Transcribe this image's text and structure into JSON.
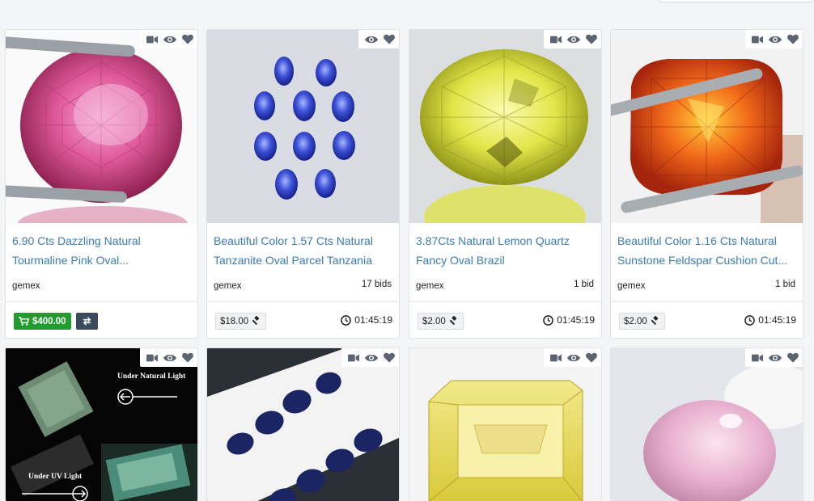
{
  "cards": [
    {
      "title": "6.90 Cts Dazzling Natural Tourmaline Pink Oval...",
      "seller": "gemex",
      "bids": "",
      "buy_now": "$400.00",
      "price": "",
      "timer": "",
      "icons": [
        "video-icon",
        "eye-icon",
        "heart-icon"
      ]
    },
    {
      "title": "Beautiful Color 1.57 Cts Natural Tanzanite Oval Parcel Tanzania",
      "seller": "gemex",
      "bids": "17 bids",
      "price": "$18.00",
      "timer": "01:45:19",
      "icons": [
        "eye-icon",
        "heart-icon"
      ]
    },
    {
      "title": "3.87Cts Natural Lemon Quartz Fancy Oval Brazil",
      "seller": "gemex",
      "bids": "1 bid",
      "price": "$2.00",
      "timer": "01:45:19",
      "icons": [
        "video-icon",
        "eye-icon",
        "heart-icon"
      ]
    },
    {
      "title": "Beautiful Color 1.16 Cts Natural Sunstone Feldspar Cushion Cut...",
      "seller": "gemex",
      "bids": "1 bid",
      "price": "$2.00",
      "timer": "01:45:19",
      "icons": [
        "video-icon",
        "eye-icon",
        "heart-icon"
      ]
    }
  ],
  "row2": [
    {
      "icons": [
        "video-icon",
        "eye-icon",
        "heart-icon"
      ],
      "caption_top": "Under Natural Light",
      "caption_bottom": "Under UV Light"
    },
    {
      "icons": [
        "video-icon",
        "eye-icon",
        "heart-icon"
      ]
    },
    {
      "icons": [
        "video-icon",
        "eye-icon",
        "heart-icon"
      ]
    },
    {
      "icons": [
        "video-icon",
        "eye-icon",
        "heart-icon"
      ]
    }
  ],
  "colors": {
    "link": "#3d7bb3",
    "buy_now": "#1f9d2f",
    "swap": "#3b4a5c",
    "icon": "#5b6470"
  }
}
